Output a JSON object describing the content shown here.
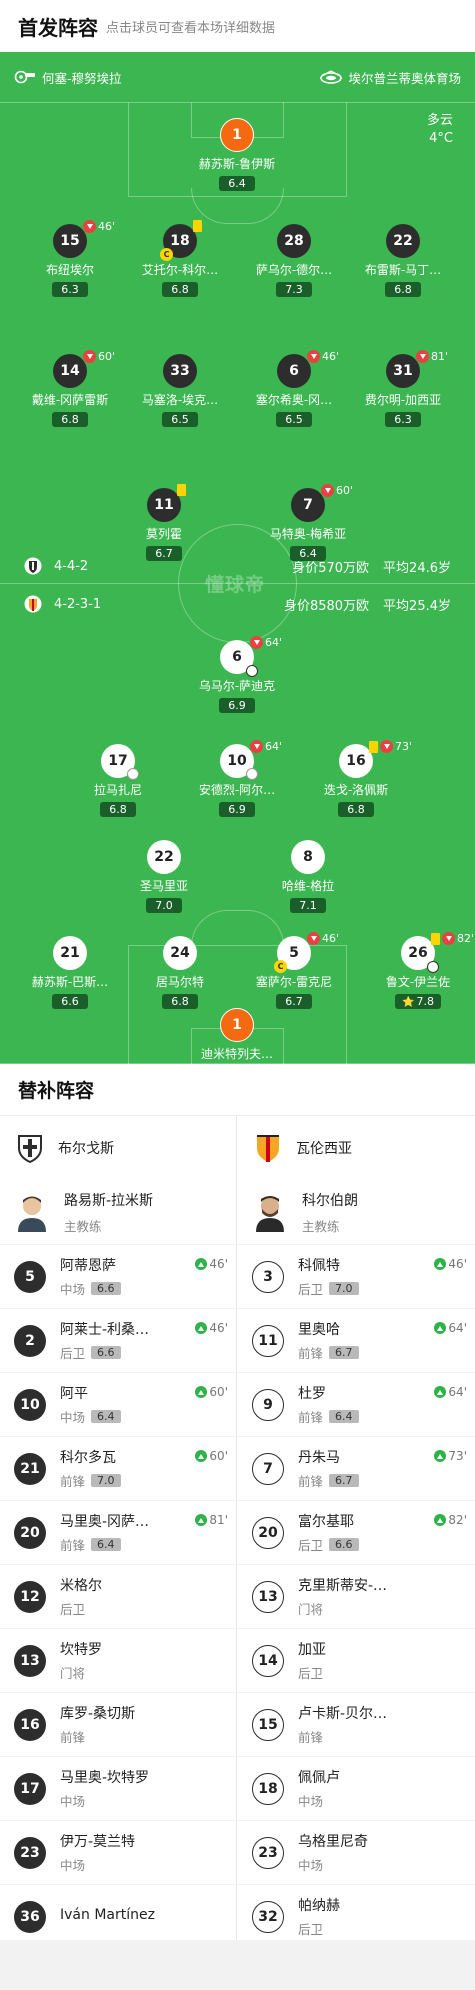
{
  "header": {
    "title": "首发阵容",
    "subtitle": "点击球员可查看本场详细数据"
  },
  "venue": {
    "referee": "何塞-穆努埃拉",
    "stadium": "埃尔普兰蒂奥体育场"
  },
  "weather": {
    "condition": "多云",
    "temperature": "4°C"
  },
  "watermark": "懂球帝",
  "home_team": {
    "name": "布尔戈斯",
    "formation": "4-4-2",
    "value": "身价570万欧",
    "avg_age": "平均24.6岁",
    "colors": {
      "kit": "#2d2d2d",
      "goalkeeper": "#f56a11"
    }
  },
  "away_team": {
    "name": "瓦伦西亚",
    "formation": "4-2-3-1",
    "value": "身价8580万欧",
    "avg_age": "平均25.4岁",
    "colors": {
      "kit": "#ffffff",
      "goalkeeper": "#f56a11"
    }
  },
  "home_players": [
    {
      "num": "1",
      "name": "赫苏斯-鲁伊斯",
      "rating": "6.4",
      "kit": "orange"
    },
    {
      "num": "15",
      "name": "布纽埃尔",
      "rating": "6.3",
      "kit": "dark",
      "sub_out": "46'"
    },
    {
      "num": "18",
      "name": "艾托尔-科尔…",
      "rating": "6.8",
      "kit": "dark",
      "yellow": true,
      "captain": "C"
    },
    {
      "num": "28",
      "name": "萨乌尔-德尔…",
      "rating": "7.3",
      "kit": "dark"
    },
    {
      "num": "22",
      "name": "布雷斯-马丁…",
      "rating": "6.8",
      "kit": "dark"
    },
    {
      "num": "14",
      "name": "戴维-冈萨雷斯",
      "rating": "6.8",
      "kit": "dark",
      "sub_out": "60'"
    },
    {
      "num": "33",
      "name": "马塞洛-埃克…",
      "rating": "6.5",
      "kit": "dark"
    },
    {
      "num": "6",
      "name": "塞尔希奥-冈…",
      "rating": "6.5",
      "kit": "dark",
      "sub_out": "46'"
    },
    {
      "num": "31",
      "name": "费尔明-加西亚",
      "rating": "6.3",
      "kit": "dark",
      "sub_out": "81'"
    },
    {
      "num": "11",
      "name": "莫列霍",
      "rating": "6.7",
      "kit": "dark",
      "yellow": true
    },
    {
      "num": "7",
      "name": "马特奥-梅希亚",
      "rating": "6.4",
      "kit": "dark",
      "sub_out": "60'"
    }
  ],
  "away_players": [
    {
      "num": "6",
      "name": "乌马尔-萨迪克",
      "rating": "6.9",
      "kit": "light",
      "sub_out": "64'",
      "goal": true
    },
    {
      "num": "17",
      "name": "拉马扎尼",
      "rating": "6.8",
      "kit": "light",
      "assist": true
    },
    {
      "num": "10",
      "name": "安德烈-阿尔…",
      "rating": "6.9",
      "kit": "light",
      "sub_out": "64'",
      "assist": true
    },
    {
      "num": "16",
      "name": "迭戈-洛佩斯",
      "rating": "6.8",
      "kit": "light",
      "yellow": true,
      "sub_out": "73'"
    },
    {
      "num": "22",
      "name": "圣马里亚",
      "rating": "7.0",
      "kit": "light"
    },
    {
      "num": "8",
      "name": "哈维-格拉",
      "rating": "7.1",
      "kit": "light"
    },
    {
      "num": "21",
      "name": "赫苏斯-巴斯…",
      "rating": "6.6",
      "kit": "light"
    },
    {
      "num": "24",
      "name": "居马尔特",
      "rating": "6.8",
      "kit": "light"
    },
    {
      "num": "5",
      "name": "塞萨尔-雷克尼",
      "rating": "6.7",
      "kit": "light",
      "sub_out": "46'",
      "captain": "C"
    },
    {
      "num": "26",
      "name": "鲁文-伊兰佐",
      "rating": "7.8",
      "kit": "light",
      "yellow": true,
      "sub_out": "82'",
      "goal": true,
      "star": true
    },
    {
      "num": "1",
      "name": "迪米特列夫…",
      "rating": "6.8",
      "kit": "orange"
    }
  ],
  "subs_title": "替补阵容",
  "home_coach": {
    "name": "路易斯-拉米斯",
    "role": "主教练"
  },
  "away_coach": {
    "name": "科尔伯朗",
    "role": "主教练"
  },
  "home_subs": [
    {
      "num": "5",
      "name": "阿蒂恩萨",
      "pos": "中场",
      "rating": "6.6",
      "in": "46'"
    },
    {
      "num": "2",
      "name": "阿莱士-利桑…",
      "pos": "后卫",
      "rating": "6.6",
      "in": "46'"
    },
    {
      "num": "10",
      "name": "阿平",
      "pos": "中场",
      "rating": "6.4",
      "in": "60'"
    },
    {
      "num": "21",
      "name": "科尔多瓦",
      "pos": "前锋",
      "rating": "7.0",
      "in": "60'"
    },
    {
      "num": "20",
      "name": "马里奥-冈萨…",
      "pos": "前锋",
      "rating": "6.4",
      "in": "81'"
    },
    {
      "num": "12",
      "name": "米格尔",
      "pos": "后卫"
    },
    {
      "num": "13",
      "name": "坎特罗",
      "pos": "门将"
    },
    {
      "num": "16",
      "name": "库罗-桑切斯",
      "pos": "前锋"
    },
    {
      "num": "17",
      "name": "马里奥-坎特罗",
      "pos": "中场"
    },
    {
      "num": "23",
      "name": "伊万-莫兰特",
      "pos": "中场"
    },
    {
      "num": "36",
      "name": "Iván Martínez",
      "pos": ""
    }
  ],
  "away_subs": [
    {
      "num": "3",
      "name": "科佩特",
      "pos": "后卫",
      "rating": "7.0",
      "in": "46'"
    },
    {
      "num": "11",
      "name": "里奥哈",
      "pos": "前锋",
      "rating": "6.7",
      "in": "64'"
    },
    {
      "num": "9",
      "name": "杜罗",
      "pos": "前锋",
      "rating": "6.4",
      "in": "64'"
    },
    {
      "num": "7",
      "name": "丹朱马",
      "pos": "前锋",
      "rating": "6.7",
      "in": "73'"
    },
    {
      "num": "20",
      "name": "富尔基耶",
      "pos": "后卫",
      "rating": "6.6",
      "in": "82'"
    },
    {
      "num": "13",
      "name": "克里斯蒂安-…",
      "pos": "门将"
    },
    {
      "num": "14",
      "name": "加亚",
      "pos": "后卫"
    },
    {
      "num": "15",
      "name": "卢卡斯-贝尔…",
      "pos": "前锋"
    },
    {
      "num": "18",
      "name": "佩佩卢",
      "pos": "中场"
    },
    {
      "num": "23",
      "name": "乌格里尼奇",
      "pos": "中场"
    },
    {
      "num": "32",
      "name": "帕纳赫",
      "pos": "后卫"
    }
  ]
}
